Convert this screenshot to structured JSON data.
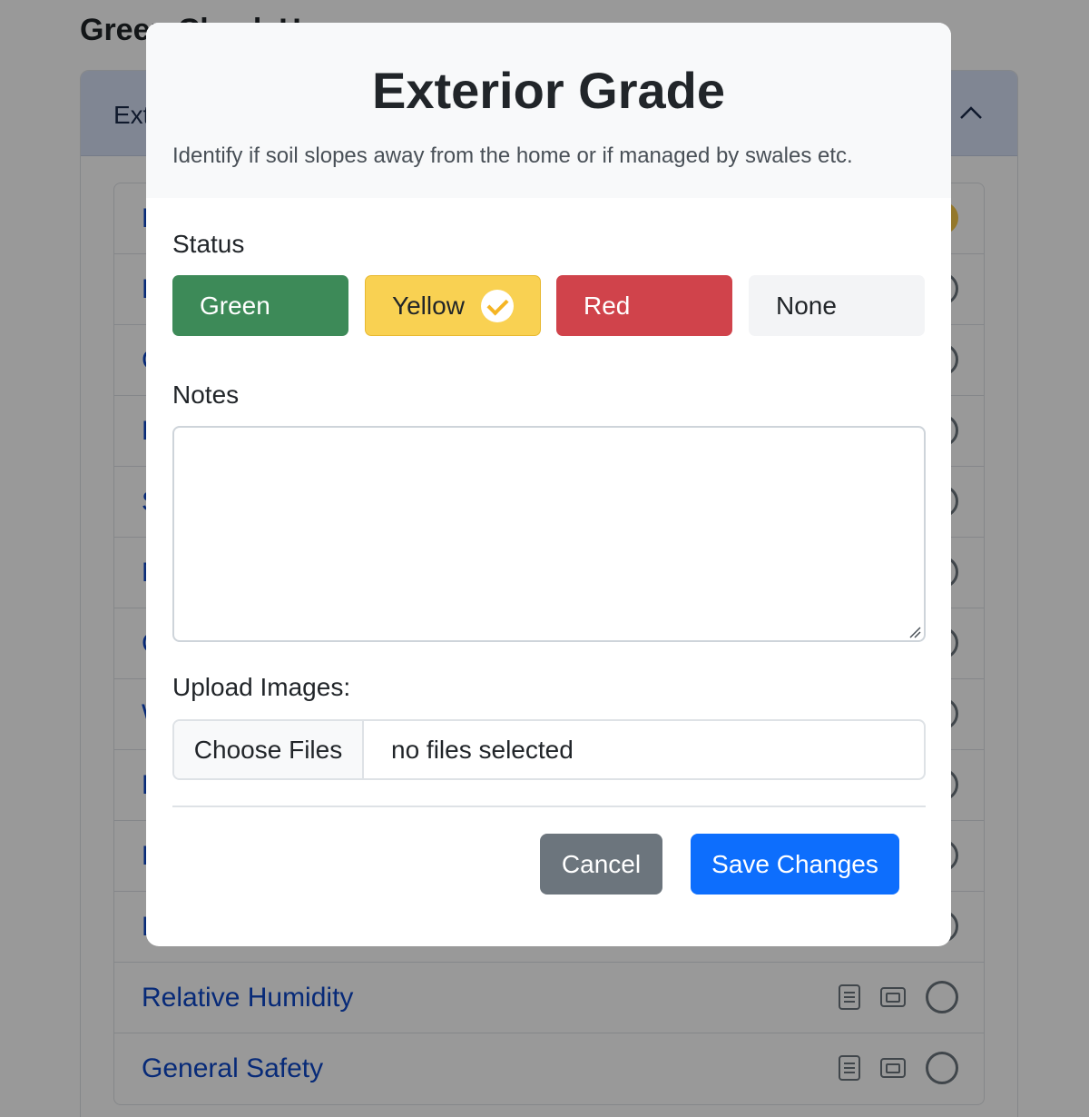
{
  "background": {
    "page_title": "Green Check Home",
    "section_header": "Exterior",
    "rows": [
      {
        "label": "Exterior Grade",
        "status": "yellow"
      },
      {
        "label": "Downspouts",
        "status": "none"
      },
      {
        "label": "Crawlspace",
        "status": "none"
      },
      {
        "label": "HVAC",
        "status": "none"
      },
      {
        "label": "Sump Pump",
        "status": "none"
      },
      {
        "label": "Moisture",
        "status": "none"
      },
      {
        "label": "Crawlspace Vents",
        "status": "none"
      },
      {
        "label": "Water Heater",
        "status": "none"
      },
      {
        "label": "Plumbing",
        "status": "none"
      },
      {
        "label": "HVAC Filter",
        "status": "none"
      },
      {
        "label": "Dehumidifier",
        "status": "none"
      },
      {
        "label": "Relative Humidity",
        "status": "none"
      },
      {
        "label": "General Safety",
        "status": "none"
      }
    ]
  },
  "modal": {
    "title": "Exterior Grade",
    "description": "Identify if soil slopes away from the home or if managed by swales etc.",
    "status_label": "Status",
    "status_options": [
      {
        "label": "Green",
        "color": "#3d8a58",
        "selected": false
      },
      {
        "label": "Yellow",
        "color": "#f9d152",
        "selected": true
      },
      {
        "label": "Red",
        "color": "#d0434b",
        "selected": false
      },
      {
        "label": "None",
        "color": "#f3f4f6",
        "selected": false
      }
    ],
    "notes_label": "Notes",
    "notes_value": "",
    "upload_label": "Upload Images:",
    "choose_files_label": "Choose Files",
    "file_status": "no files selected",
    "cancel_label": "Cancel",
    "save_label": "Save Changes"
  }
}
